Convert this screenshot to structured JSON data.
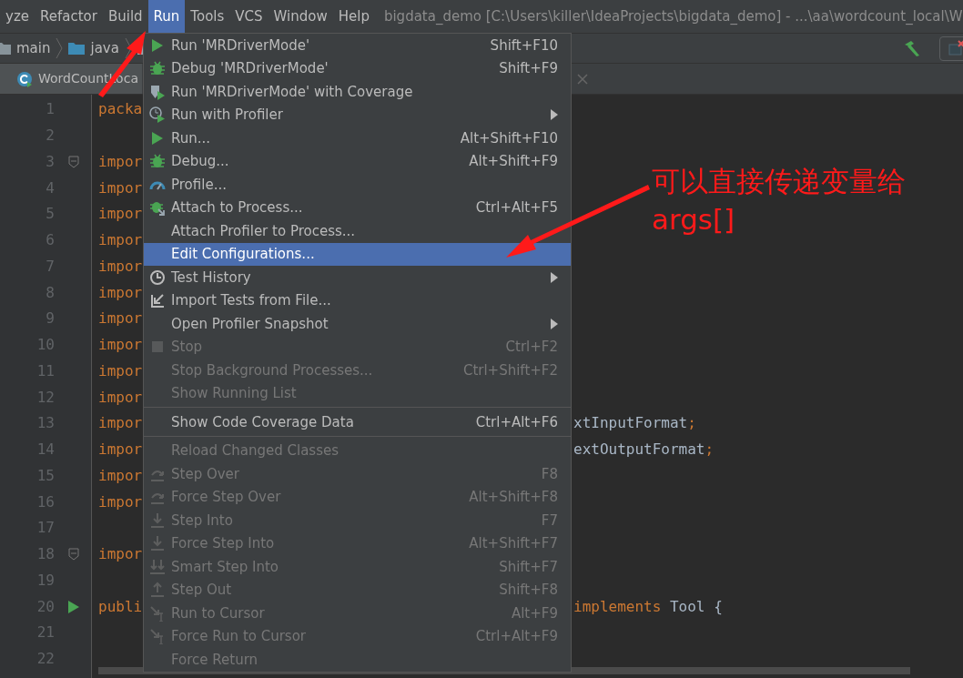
{
  "menu_bar": {
    "items": [
      {
        "label": "yze",
        "selected": false
      },
      {
        "label": "Refactor",
        "selected": false
      },
      {
        "label": "Build",
        "selected": false
      },
      {
        "label": "Run",
        "selected": true
      },
      {
        "label": "Tools",
        "selected": false
      },
      {
        "label": "VCS",
        "selected": false
      },
      {
        "label": "Window",
        "selected": false
      },
      {
        "label": "Help",
        "selected": false
      }
    ],
    "title": "bigdata_demo [C:\\Users\\killer\\IdeaProjects\\bigdata_demo] - ...\\aa\\wordcount_local\\W"
  },
  "breadcrumbs": [
    {
      "label": "main",
      "kind": "folder"
    },
    {
      "label": "java",
      "kind": "source-folder"
    },
    {
      "kind": "package"
    }
  ],
  "editor_tab": {
    "label": "WordCountLoca"
  },
  "editor": {
    "lines": [
      {
        "number": "1",
        "left": "packa"
      },
      {
        "number": "2"
      },
      {
        "number": "3",
        "left": "impor",
        "kind": "fold"
      },
      {
        "number": "4",
        "left": "impor"
      },
      {
        "number": "5",
        "left": "impor"
      },
      {
        "number": "6",
        "left": "impor"
      },
      {
        "number": "7",
        "left": "impor"
      },
      {
        "number": "8",
        "left": "impor"
      },
      {
        "number": "9",
        "left": "impor"
      },
      {
        "number": "10",
        "left": "impor"
      },
      {
        "number": "11",
        "left": "impor"
      },
      {
        "number": "12",
        "left": "impor"
      },
      {
        "number": "13",
        "left": "impor",
        "right": [
          {
            "text": "xtInputFormat",
            "kind": "plain"
          },
          {
            "text": ";",
            "kind": "keyword"
          }
        ]
      },
      {
        "number": "14",
        "left": "impor",
        "right": [
          {
            "text": "extOutputFormat",
            "kind": "plain"
          },
          {
            "text": ";",
            "kind": "keyword"
          }
        ]
      },
      {
        "number": "15",
        "left": "impor"
      },
      {
        "number": "16",
        "left": "impor"
      },
      {
        "number": "17"
      },
      {
        "number": "18",
        "left": "impor",
        "kind": "fold"
      },
      {
        "number": "19"
      },
      {
        "number": "20",
        "left": "publi",
        "kind": "run",
        "right": [
          {
            "text": "implements",
            "kind": "keyword"
          },
          {
            "text": " Tool {",
            "kind": "plain"
          }
        ]
      },
      {
        "number": "21"
      },
      {
        "number": "22"
      }
    ]
  },
  "run_menu": {
    "items": [
      {
        "kind": "run",
        "label": "Run 'MRDriverMode'",
        "shortcut": "Shift+F10",
        "disabled": false,
        "selected": false,
        "submenu": false
      },
      {
        "kind": "debug",
        "label": "Debug 'MRDriverMode'",
        "shortcut": "Shift+F9",
        "disabled": false,
        "selected": false,
        "submenu": false
      },
      {
        "kind": "coverage",
        "label": "Run 'MRDriverMode' with Coverage",
        "disabled": false,
        "selected": false,
        "submenu": false
      },
      {
        "kind": "profiler",
        "label": "Run with Profiler",
        "disabled": false,
        "selected": false,
        "submenu": true
      },
      {
        "kind": "run",
        "label": "Run...",
        "shortcut": "Alt+Shift+F10",
        "disabled": false,
        "selected": false,
        "submenu": false
      },
      {
        "kind": "debug",
        "label": "Debug...",
        "shortcut": "Alt+Shift+F9",
        "disabled": false,
        "selected": false,
        "submenu": false
      },
      {
        "kind": "gauge",
        "label": "Profile...",
        "disabled": false,
        "selected": false,
        "submenu": false
      },
      {
        "kind": "attach",
        "label": "Attach to Process...",
        "shortcut": "Ctrl+Alt+F5",
        "disabled": false,
        "selected": false,
        "submenu": false
      },
      {
        "kind": "plain",
        "label": "Attach Profiler to Process...",
        "disabled": false,
        "selected": false,
        "submenu": false
      },
      {
        "kind": "plain",
        "label": "Edit Configurations...",
        "disabled": false,
        "selected": true,
        "submenu": false
      },
      {
        "kind": "clock",
        "label": "Test History",
        "disabled": false,
        "selected": false,
        "submenu": true
      },
      {
        "kind": "import",
        "label": "Import Tests from File...",
        "disabled": false,
        "selected": false,
        "submenu": false
      },
      {
        "kind": "plain",
        "label": "Open Profiler Snapshot",
        "disabled": false,
        "selected": false,
        "submenu": true
      },
      {
        "kind": "stop",
        "label": "Stop",
        "shortcut": "Ctrl+F2",
        "disabled": true,
        "selected": false,
        "submenu": false
      },
      {
        "kind": "plain",
        "label": "Stop Background Processes...",
        "shortcut": "Ctrl+Shift+F2",
        "disabled": true,
        "selected": false,
        "submenu": false
      },
      {
        "kind": "plain",
        "label": "Show Running List",
        "disabled": true,
        "selected": false,
        "submenu": false
      },
      {
        "kind": "separator"
      },
      {
        "kind": "plain",
        "label": "Show Code Coverage Data",
        "shortcut": "Ctrl+Alt+F6",
        "disabled": false,
        "selected": false,
        "submenu": false
      },
      {
        "kind": "separator"
      },
      {
        "kind": "plain",
        "label": "Reload Changed Classes",
        "disabled": true,
        "selected": false,
        "submenu": false
      },
      {
        "kind": "step-over",
        "label": "Step Over",
        "shortcut": "F8",
        "disabled": true,
        "selected": false,
        "submenu": false
      },
      {
        "kind": "step-over",
        "label": "Force Step Over",
        "shortcut": "Alt+Shift+F8",
        "disabled": true,
        "selected": false,
        "submenu": false
      },
      {
        "kind": "step-into",
        "label": "Step Into",
        "shortcut": "F7",
        "disabled": true,
        "selected": false,
        "submenu": false
      },
      {
        "kind": "step-into",
        "label": "Force Step Into",
        "shortcut": "Alt+Shift+F7",
        "disabled": true,
        "selected": false,
        "submenu": false
      },
      {
        "kind": "smart-step",
        "label": "Smart Step Into",
        "shortcut": "Shift+F7",
        "disabled": true,
        "selected": false,
        "submenu": false
      },
      {
        "kind": "step-out",
        "label": "Step Out",
        "shortcut": "Shift+F8",
        "disabled": true,
        "selected": false,
        "submenu": false
      },
      {
        "kind": "cursor",
        "label": "Run to Cursor",
        "shortcut": "Alt+F9",
        "disabled": true,
        "selected": false,
        "submenu": false
      },
      {
        "kind": "cursor",
        "label": "Force Run to Cursor",
        "shortcut": "Ctrl+Alt+F9",
        "disabled": true,
        "selected": false,
        "submenu": false
      },
      {
        "kind": "plain",
        "label": "Force Return",
        "disabled": true,
        "selected": false,
        "submenu": false
      }
    ]
  },
  "annotation": {
    "lines": [
      "可以直接传递变量给",
      "args[]"
    ]
  }
}
